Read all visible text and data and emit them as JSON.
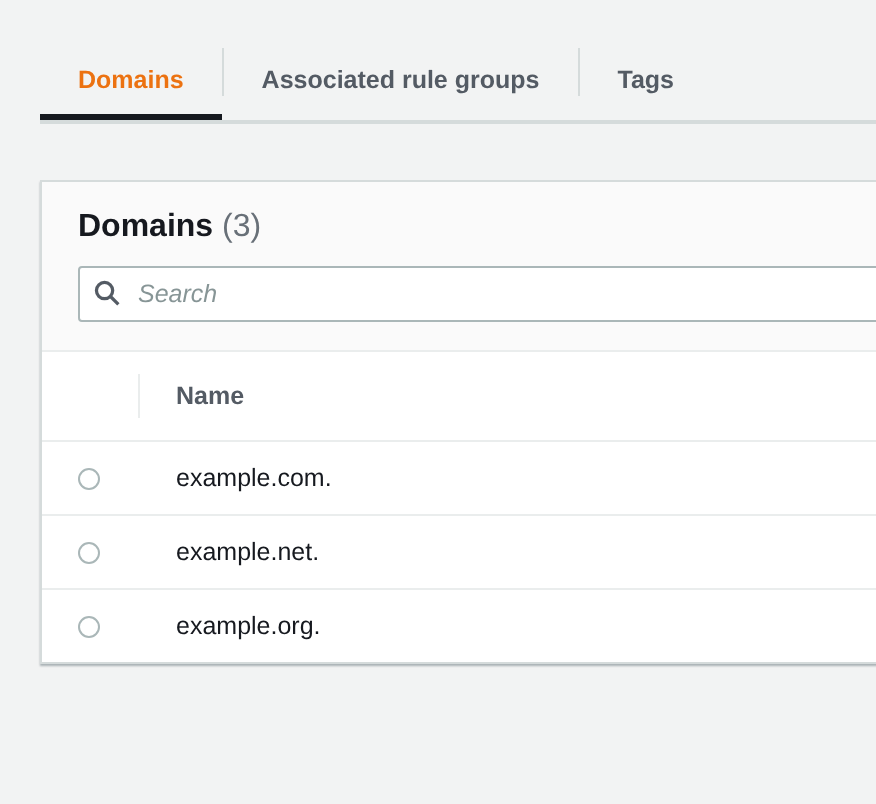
{
  "tabs": [
    {
      "label": "Domains",
      "selected": true
    },
    {
      "label": "Associated rule groups",
      "selected": false
    },
    {
      "label": "Tags",
      "selected": false
    }
  ],
  "panel": {
    "title": "Domains",
    "count": "(3)",
    "search": {
      "placeholder": "Search"
    },
    "table": {
      "columns": [
        "Name"
      ],
      "rows": [
        {
          "name": "example.com.",
          "selected": false
        },
        {
          "name": "example.net.",
          "selected": false
        },
        {
          "name": "example.org.",
          "selected": false
        }
      ]
    }
  }
}
